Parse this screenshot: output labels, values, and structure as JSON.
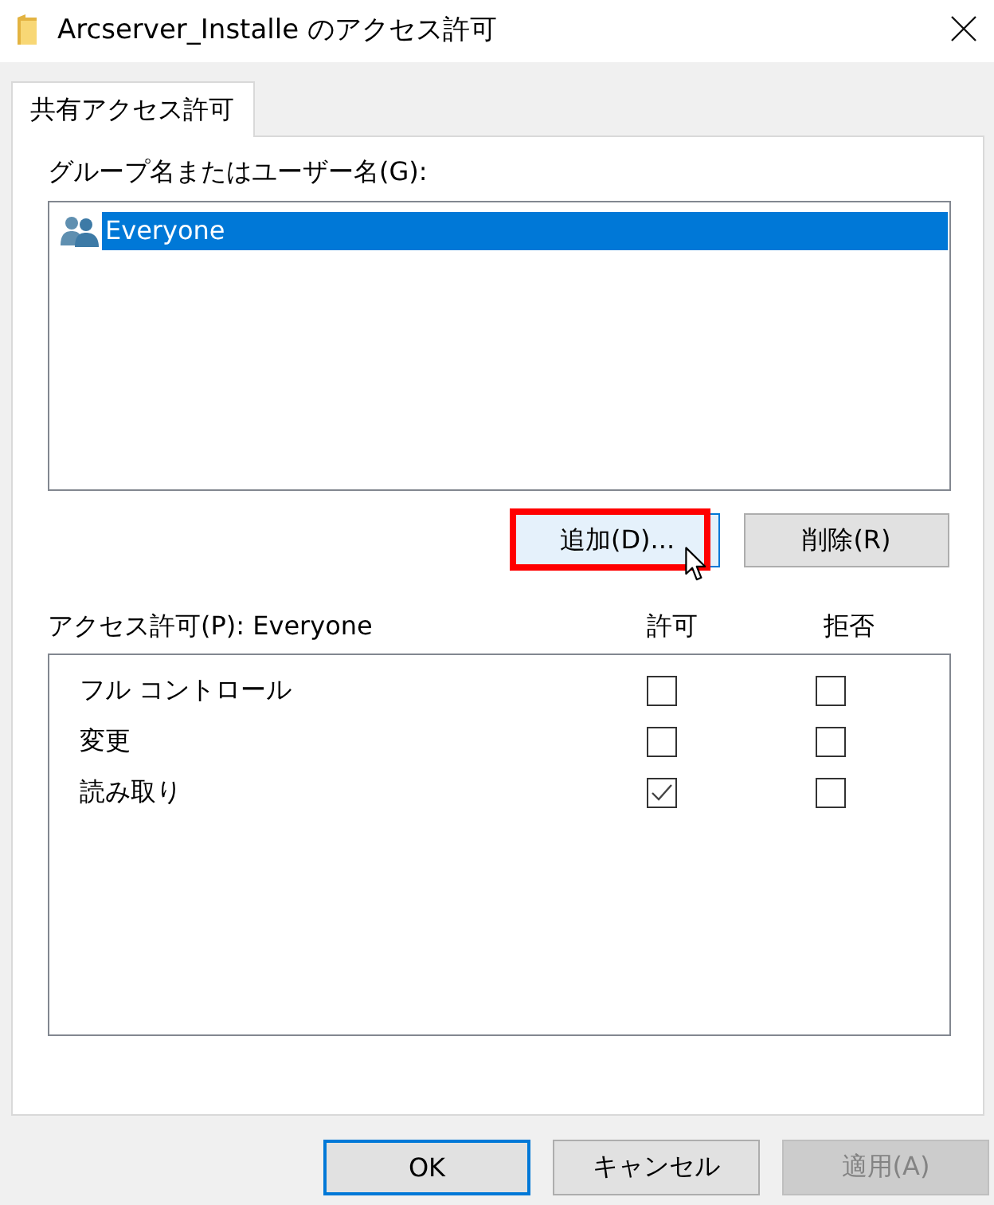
{
  "window": {
    "title": "Arcserver_Installe のアクセス許可"
  },
  "tabs": [
    {
      "label": "共有アクセス許可",
      "selected": true
    }
  ],
  "users": {
    "label": "グループ名またはユーザー名(G):",
    "items": [
      {
        "name": "Everyone",
        "selected": true
      }
    ]
  },
  "user_buttons": [
    {
      "label": "追加(D)...",
      "hovered": true,
      "highlighted": true
    },
    {
      "label": "削除(R)",
      "hovered": false,
      "highlighted": false
    }
  ],
  "permissions": {
    "label": "アクセス許可(P): Everyone",
    "columns": [
      "許可",
      "拒否"
    ],
    "rows": [
      {
        "name": "フル コントロール",
        "allow": false,
        "deny": false
      },
      {
        "name": "変更",
        "allow": false,
        "deny": false
      },
      {
        "name": "読み取り",
        "allow": true,
        "deny": false
      }
    ]
  },
  "buttons": [
    {
      "label": "OK",
      "default": true,
      "disabled": false
    },
    {
      "label": "キャンセル",
      "default": false,
      "disabled": false
    },
    {
      "label": "適用(A)",
      "default": false,
      "disabled": true
    }
  ]
}
